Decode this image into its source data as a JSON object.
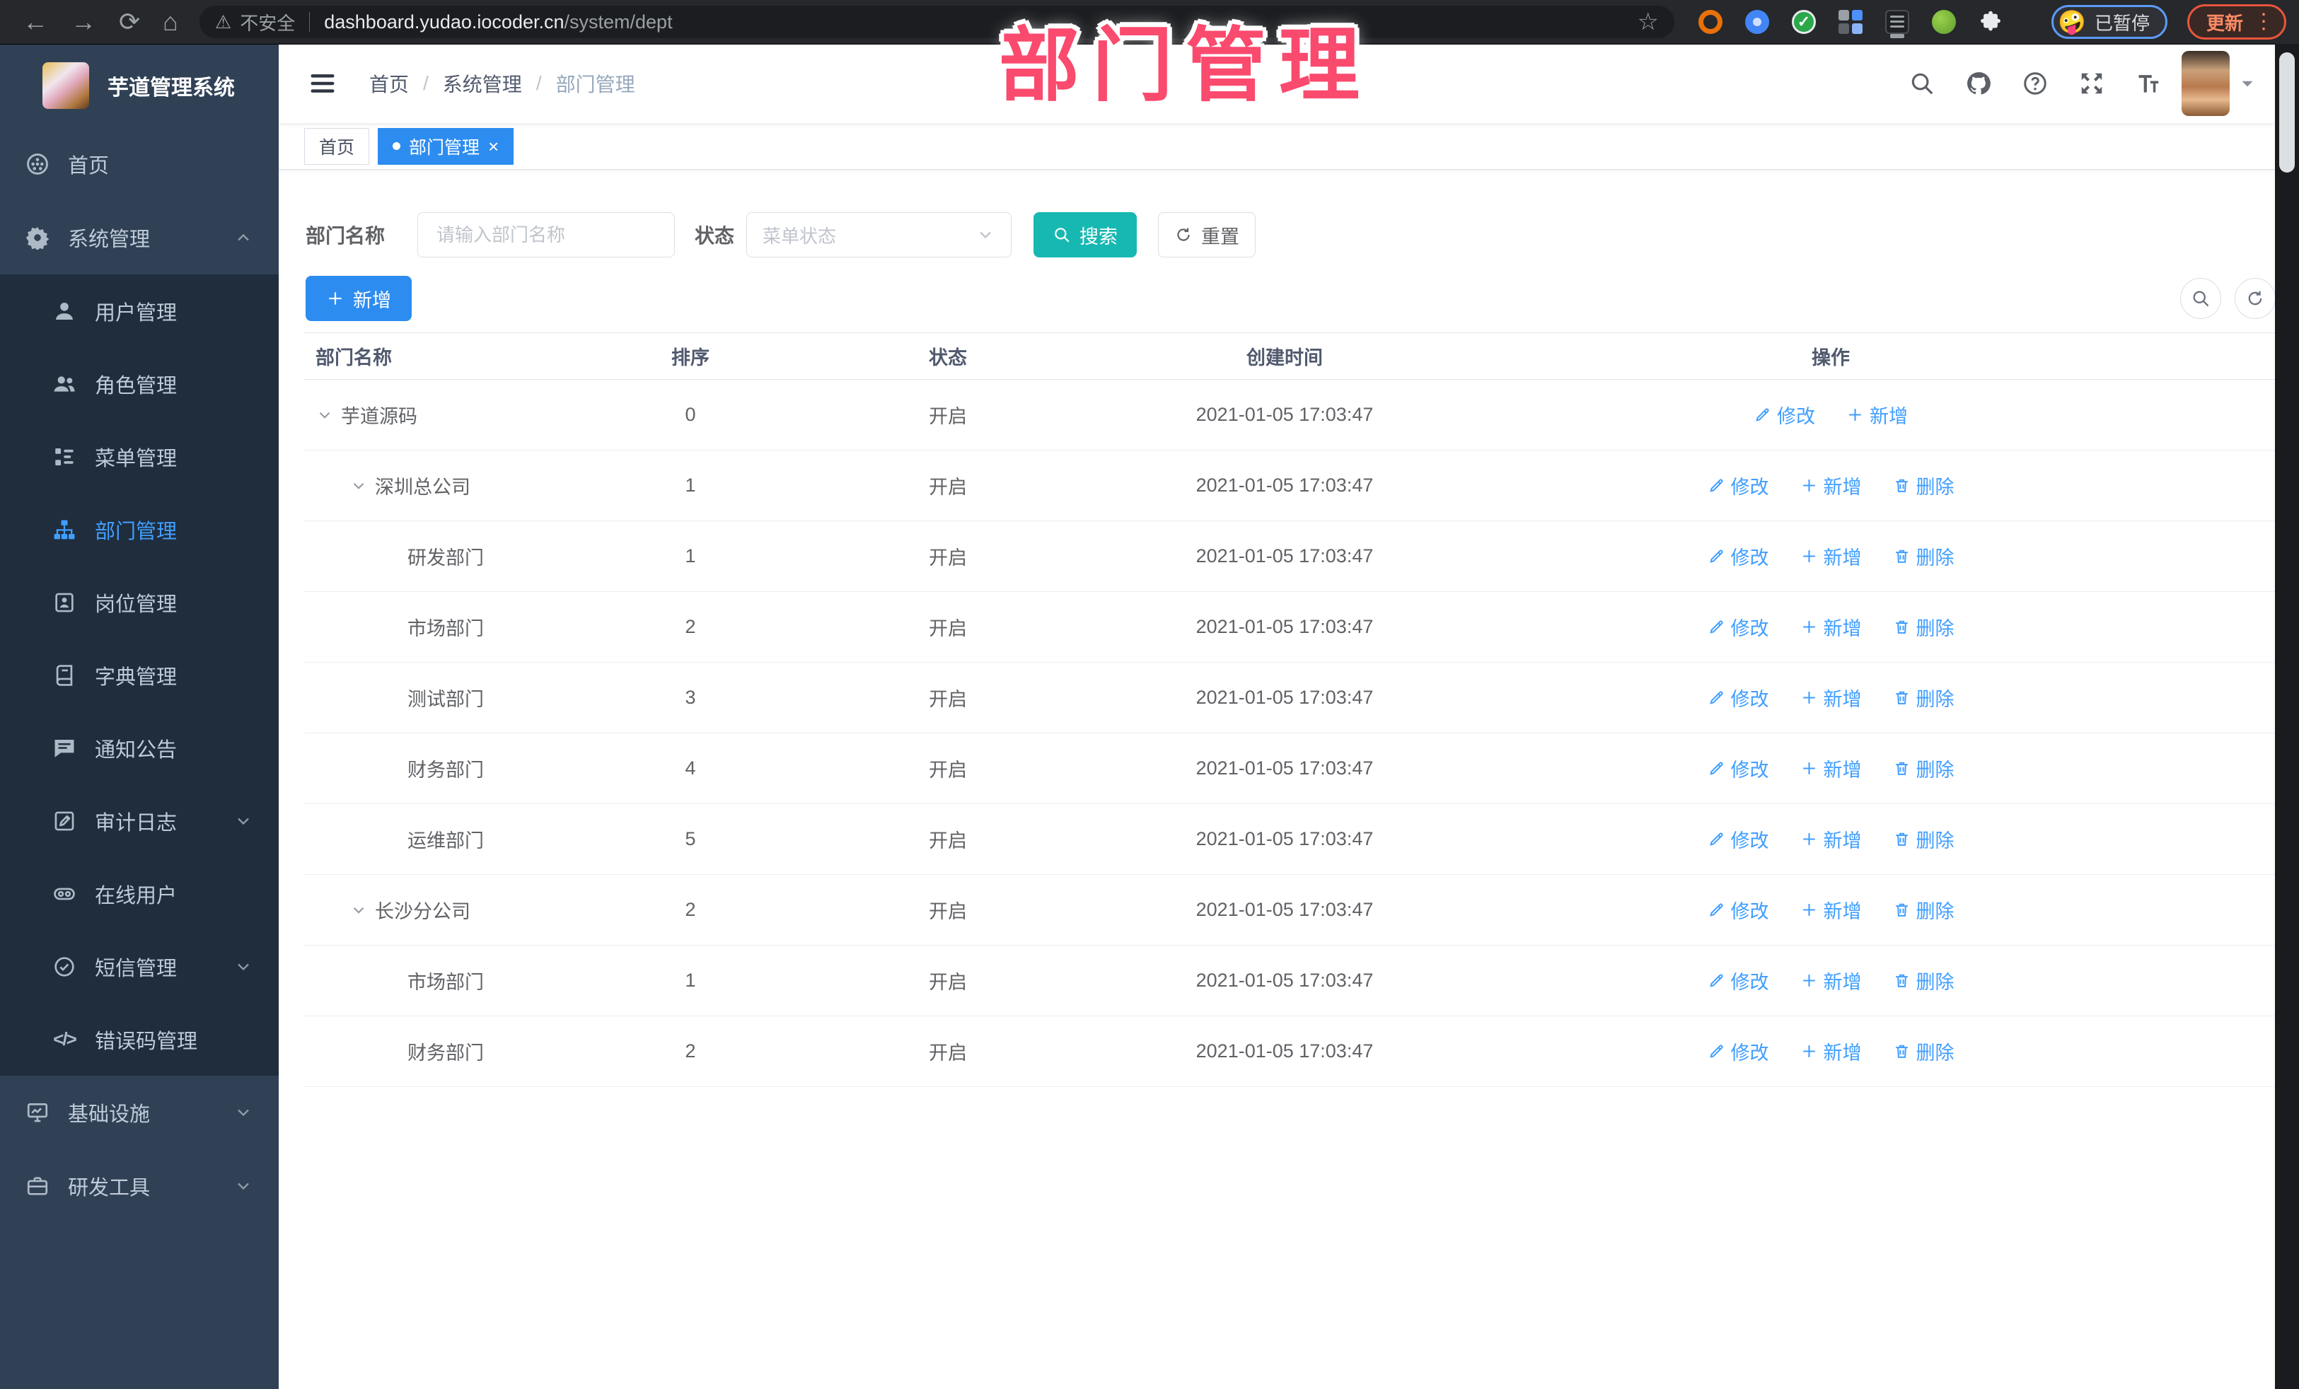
{
  "colors": {
    "accent": "#2d8cf0",
    "link": "#409eff",
    "teal": "#17b8b2",
    "pink": "#fa4a6e",
    "sidebar_bg": "#304156",
    "submenu_bg": "#1f2d3d"
  },
  "browser": {
    "security_label": "不安全",
    "url_host": "dashboard.yudao.iocoder.cn",
    "url_path": "/system/dept",
    "extension_badge": "on",
    "profile_emoji": "🤪",
    "profile_status": "已暂停",
    "update_label": "更新",
    "extensions": [
      "orange-ring",
      "blue-pin",
      "green-check",
      "grid",
      "on-badge",
      "green-leaf",
      "puzzle"
    ]
  },
  "watermark": "部门管理",
  "sidebar": {
    "title": "芋道管理系统",
    "items": [
      {
        "key": "home",
        "label": "首页",
        "icon": "dashboard-icon",
        "level": 0
      },
      {
        "key": "system",
        "label": "系统管理",
        "icon": "gear-icon",
        "level": 0,
        "chevron": "up"
      },
      {
        "key": "user",
        "label": "用户管理",
        "icon": "user-icon",
        "level": 1
      },
      {
        "key": "role",
        "label": "角色管理",
        "icon": "roles-icon",
        "level": 1
      },
      {
        "key": "menu",
        "label": "菜单管理",
        "icon": "menu-tree-icon",
        "level": 1
      },
      {
        "key": "dept",
        "label": "部门管理",
        "icon": "org-icon",
        "level": 1,
        "active": true
      },
      {
        "key": "post",
        "label": "岗位管理",
        "icon": "badge-icon",
        "level": 1
      },
      {
        "key": "dict",
        "label": "字典管理",
        "icon": "dict-icon",
        "level": 1
      },
      {
        "key": "notice",
        "label": "通知公告",
        "icon": "notice-icon",
        "level": 1
      },
      {
        "key": "audit",
        "label": "审计日志",
        "icon": "audit-icon",
        "level": 1,
        "chevron": "down"
      },
      {
        "key": "online",
        "label": "在线用户",
        "icon": "online-icon",
        "level": 1
      },
      {
        "key": "sms",
        "label": "短信管理",
        "icon": "sms-icon",
        "level": 1,
        "chevron": "down"
      },
      {
        "key": "errcode",
        "label": "错误码管理",
        "icon": "code-icon",
        "level": 1
      },
      {
        "key": "infra",
        "label": "基础设施",
        "icon": "infra-icon",
        "level": 0,
        "chevron": "down"
      },
      {
        "key": "devtools",
        "label": "研发工具",
        "icon": "tools-icon",
        "level": 0,
        "chevron": "down"
      }
    ]
  },
  "header": {
    "breadcrumb": [
      "首页",
      "系统管理",
      "部门管理"
    ],
    "separator": "/",
    "icons": [
      "search",
      "github",
      "help",
      "fullscreen",
      "fontsize"
    ]
  },
  "tabs": [
    {
      "label": "首页",
      "active": false,
      "closable": false
    },
    {
      "label": "部门管理",
      "active": true,
      "closable": true
    }
  ],
  "filters": {
    "dept_label": "部门名称",
    "dept_placeholder": "请输入部门名称",
    "status_label": "状态",
    "status_placeholder": "菜单状态",
    "search_label": "搜索",
    "reset_label": "重置"
  },
  "toolbar": {
    "add_label": "新增"
  },
  "table": {
    "columns": [
      "部门名称",
      "排序",
      "状态",
      "创建时间",
      "操作"
    ],
    "action_labels": {
      "edit": "修改",
      "add": "新增",
      "delete": "删除"
    },
    "rows": [
      {
        "name": "芋道源码",
        "level": 0,
        "expanded": true,
        "sort": "0",
        "status": "开启",
        "created": "2021-01-05 17:03:47",
        "actions": [
          "edit",
          "add"
        ]
      },
      {
        "name": "深圳总公司",
        "level": 1,
        "expanded": true,
        "sort": "1",
        "status": "开启",
        "created": "2021-01-05 17:03:47",
        "actions": [
          "edit",
          "add",
          "delete"
        ]
      },
      {
        "name": "研发部门",
        "level": 2,
        "expanded": false,
        "sort": "1",
        "status": "开启",
        "created": "2021-01-05 17:03:47",
        "actions": [
          "edit",
          "add",
          "delete"
        ]
      },
      {
        "name": "市场部门",
        "level": 2,
        "expanded": false,
        "sort": "2",
        "status": "开启",
        "created": "2021-01-05 17:03:47",
        "actions": [
          "edit",
          "add",
          "delete"
        ]
      },
      {
        "name": "测试部门",
        "level": 2,
        "expanded": false,
        "sort": "3",
        "status": "开启",
        "created": "2021-01-05 17:03:47",
        "actions": [
          "edit",
          "add",
          "delete"
        ]
      },
      {
        "name": "财务部门",
        "level": 2,
        "expanded": false,
        "sort": "4",
        "status": "开启",
        "created": "2021-01-05 17:03:47",
        "actions": [
          "edit",
          "add",
          "delete"
        ]
      },
      {
        "name": "运维部门",
        "level": 2,
        "expanded": false,
        "sort": "5",
        "status": "开启",
        "created": "2021-01-05 17:03:47",
        "actions": [
          "edit",
          "add",
          "delete"
        ]
      },
      {
        "name": "长沙分公司",
        "level": 1,
        "expanded": true,
        "sort": "2",
        "status": "开启",
        "created": "2021-01-05 17:03:47",
        "actions": [
          "edit",
          "add",
          "delete"
        ]
      },
      {
        "name": "市场部门",
        "level": 2,
        "expanded": false,
        "sort": "1",
        "status": "开启",
        "created": "2021-01-05 17:03:47",
        "actions": [
          "edit",
          "add",
          "delete"
        ]
      },
      {
        "name": "财务部门",
        "level": 2,
        "expanded": false,
        "sort": "2",
        "status": "开启",
        "created": "2021-01-05 17:03:47",
        "actions": [
          "edit",
          "add",
          "delete"
        ]
      }
    ]
  }
}
